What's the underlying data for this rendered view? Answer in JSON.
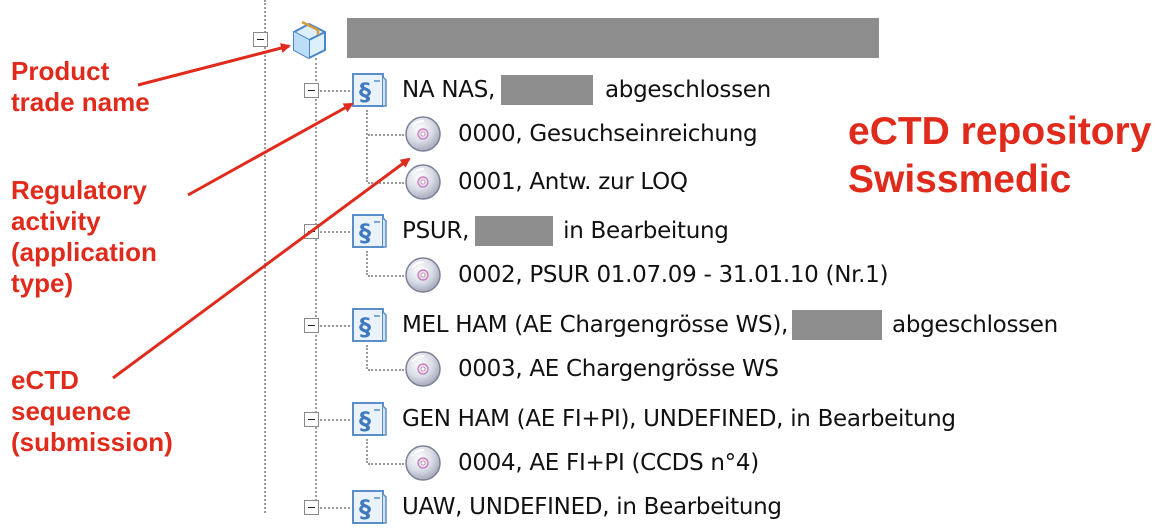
{
  "annotations": {
    "product_trade_name": [
      "Product",
      "trade name"
    ],
    "regulatory_activity": [
      "Regulatory",
      "activity",
      "(application",
      "type)"
    ],
    "ectd_sequence": [
      "eCTD",
      "sequence",
      "(submission)"
    ],
    "repository_title": [
      "eCTD repository",
      "Swissmedic"
    ]
  },
  "tree": {
    "root": {
      "icon": "package-icon",
      "label_redacted": true
    },
    "activities": [
      {
        "icon": "section-icon",
        "label_prefix": "NA NAS,",
        "label_redacted": true,
        "status": "abgeschlossen",
        "sequences": [
          {
            "icon": "cd-icon",
            "label": "0000, Gesuchseinreichung"
          },
          {
            "icon": "cd-icon",
            "label": "0001, Antw. zur LOQ"
          }
        ]
      },
      {
        "icon": "section-icon",
        "label_prefix": "PSUR,",
        "label_redacted": true,
        "status": "in Bearbeitung",
        "sequences": [
          {
            "icon": "cd-icon",
            "label": "0002, PSUR 01.07.09 - 31.01.10 (Nr.1)"
          }
        ]
      },
      {
        "icon": "section-icon",
        "label_prefix": "MEL HAM (AE Chargengrösse WS),",
        "label_redacted": true,
        "status": "abgeschlossen",
        "sequences": [
          {
            "icon": "cd-icon",
            "label": "0003, AE Chargengrösse WS"
          }
        ]
      },
      {
        "icon": "section-icon",
        "label_prefix": "GEN HAM (AE FI+PI), UNDEFINED, in Bearbeitung",
        "label_redacted": false,
        "status": "",
        "sequences": [
          {
            "icon": "cd-icon",
            "label": "0004, AE FI+PI (CCDS n°4)"
          }
        ]
      },
      {
        "icon": "section-icon",
        "label_prefix": "UAW, UNDEFINED, in Bearbeitung",
        "label_redacted": false,
        "status": "",
        "sequences": []
      }
    ]
  },
  "colors": {
    "annotation": "#e02b1c",
    "redaction": "#8d8d8d",
    "tree_line": "#9a9a9a"
  }
}
